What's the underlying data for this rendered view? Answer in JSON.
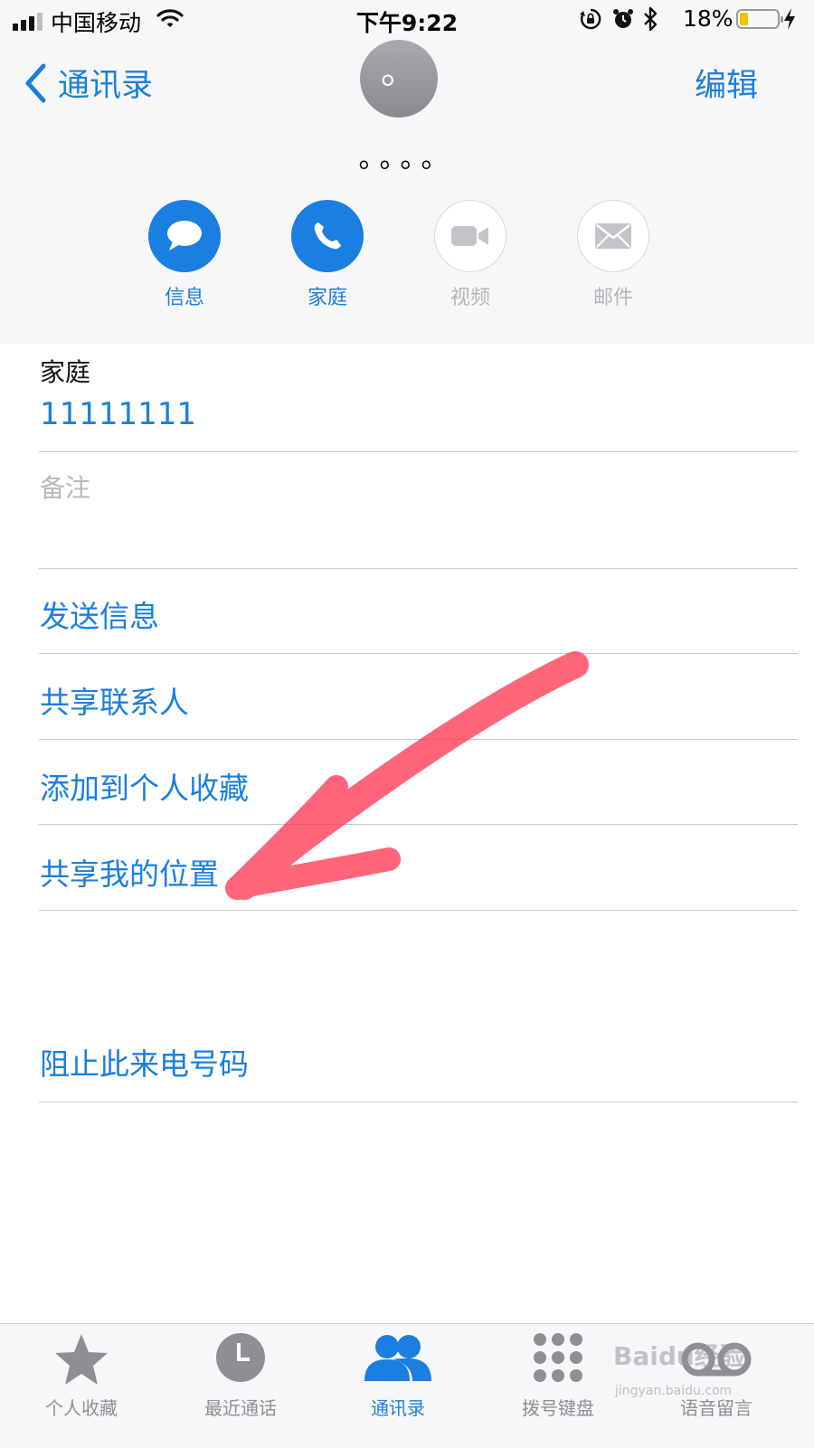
{
  "status_bar": {
    "carrier": "中国移动",
    "time": "下午9:22",
    "battery_percent": "18%",
    "battery_level": 0.18,
    "signal_bars": 3,
    "signal_bars_total": 4
  },
  "nav": {
    "back_label": "通讯录",
    "edit_label": "编辑"
  },
  "contact": {
    "avatar_text": "。",
    "name": "。。。。"
  },
  "actions": [
    {
      "label": "信息",
      "icon": "message-icon",
      "enabled": true
    },
    {
      "label": "家庭",
      "icon": "phone-icon",
      "enabled": true
    },
    {
      "label": "视频",
      "icon": "video-icon",
      "enabled": false
    },
    {
      "label": "邮件",
      "icon": "mail-icon",
      "enabled": false
    }
  ],
  "phone_field": {
    "label": "家庭",
    "value": "11111111"
  },
  "notes_placeholder": "备注",
  "links": {
    "send_message": "发送信息",
    "share_contact": "共享联系人",
    "add_favorites": "添加到个人收藏",
    "share_location": "共享我的位置",
    "block_caller": "阻止此来电号码"
  },
  "tabs": [
    {
      "label": "个人收藏",
      "icon": "star-icon",
      "active": false
    },
    {
      "label": "最近通话",
      "icon": "clock-icon",
      "active": false
    },
    {
      "label": "通讯录",
      "icon": "contacts-icon",
      "active": true
    },
    {
      "label": "拨号键盘",
      "icon": "keypad-icon",
      "active": false
    },
    {
      "label": "语音留言",
      "icon": "voicemail-icon",
      "active": false
    }
  ],
  "watermark": {
    "brand": "Baidu经验",
    "url": "jingyan.baidu.com"
  },
  "colors": {
    "accent": "#1a7fe0",
    "annotation": "#ff3b55",
    "battery": "#f2c200"
  }
}
